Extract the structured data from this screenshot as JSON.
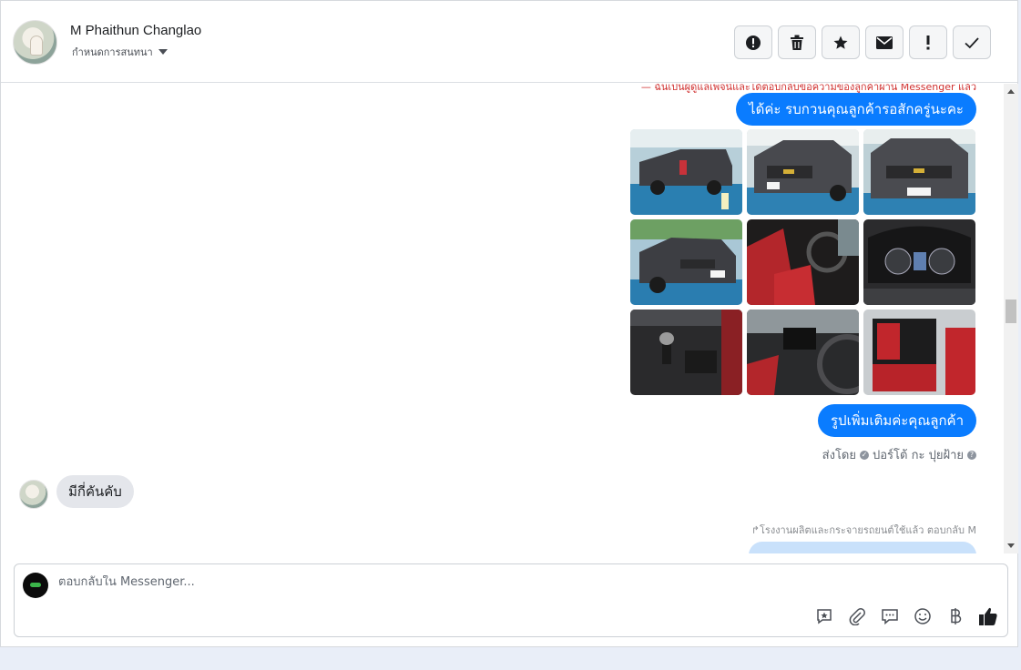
{
  "header": {
    "contact_name": "M Phaithun Changlao",
    "assign_label": "กำหนดการสนทนา",
    "toolbar": [
      {
        "name": "spam-button",
        "icon": "exclamation-circle-icon"
      },
      {
        "name": "delete-button",
        "icon": "trash-icon"
      },
      {
        "name": "star-button",
        "icon": "star-icon"
      },
      {
        "name": "mark-unread-button",
        "icon": "envelope-icon"
      },
      {
        "name": "priority-button",
        "icon": "exclamation-icon"
      },
      {
        "name": "done-button",
        "icon": "check-icon"
      }
    ]
  },
  "chat": {
    "red_notice": "— ฉันเป็นผู้ดูแลเพจนี้และได้ตอบกลับข้อความของลูกค้าผ่าน Messenger แล้ว",
    "msg_out_1": "ได้ค่ะ รบกวนคุณลูกค้ารอสักครู่นะคะ",
    "photos": [
      {
        "name": "photo-rear-truck",
        "kind": "exterior"
      },
      {
        "name": "photo-front-truck",
        "kind": "exterior"
      },
      {
        "name": "photo-front-plate",
        "kind": "exterior"
      },
      {
        "name": "photo-side-front",
        "kind": "exterior"
      },
      {
        "name": "photo-driver-seat",
        "kind": "interior-red"
      },
      {
        "name": "photo-gauge-cluster",
        "kind": "dash"
      },
      {
        "name": "photo-gear-shift",
        "kind": "interior-dark"
      },
      {
        "name": "photo-dashboard",
        "kind": "interior-red"
      },
      {
        "name": "photo-rear-seats",
        "kind": "interior-red"
      }
    ],
    "msg_out_2": "รูปเพิ่มเติมค่ะคุณลูกค้า",
    "sent_by_prefix": "ส่งโดย",
    "sent_by_name": "ปอร์โต้ กะ ปุยฝ้าย",
    "msg_in_1": "มีกี่คันคับ",
    "reply_note": "โรงงานผลิตและกระจายรถยนต์ใช้แล้ว ตอบกลับ M"
  },
  "composer": {
    "placeholder": "ตอบกลับใน Messenger...",
    "actions": [
      "saved-reply-icon",
      "attachment-icon",
      "message-icon",
      "emoji-icon",
      "baht-icon",
      "like-icon"
    ]
  },
  "colors": {
    "outgoing": "#0a7cff",
    "incoming": "#e4e6eb",
    "notice_red": "#d0302f"
  }
}
